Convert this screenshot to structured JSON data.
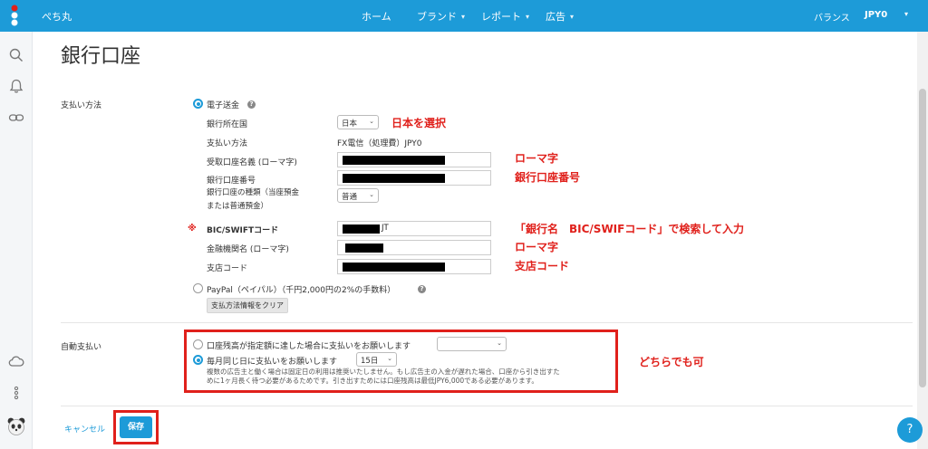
{
  "topbar": {
    "brand": "ぺち丸",
    "nav": [
      {
        "label": "ホーム",
        "has_menu": false
      },
      {
        "label": "ブランド",
        "has_menu": true
      },
      {
        "label": "レポート",
        "has_menu": true
      },
      {
        "label": "広告",
        "has_menu": true
      }
    ],
    "balance_label": "バランス",
    "balance_value": "JPY0"
  },
  "page": {
    "title": "銀行口座"
  },
  "payment": {
    "section_label": "支払い方法",
    "wire": {
      "label": "電子送金",
      "selected": true,
      "bank_country_label": "銀行所在国",
      "bank_country_value": "日本",
      "method_label": "支払い方法",
      "method_value": "FX電信（処理費）JPY0",
      "account_name_label": "受取口座名義 (ローマ字)",
      "account_number_label": "銀行口座番号",
      "account_type_label": "銀行口座の種類（当座預金",
      "account_type_label_2": "または普通預金）",
      "account_type_value": "普通",
      "swift_label": "BIC/SWIFTコード",
      "swift_tail": "JT",
      "bank_name_label": "金融機関名 (ローマ字)",
      "branch_label": "支店コード"
    },
    "paypal": {
      "label": "PayPal（ペイパル）（千円2,000円の2%の手数料）",
      "selected": false
    },
    "clear_button": "支払方法情報をクリア"
  },
  "auto_pay": {
    "section_label": "自動支払い",
    "option1": {
      "label": "口座残高が指定額に達した場合に支払いをお願いします",
      "selected": false,
      "value": ""
    },
    "option2": {
      "label": "毎月同じ日に支払いをお願いします",
      "selected": true,
      "value": "15日"
    },
    "note_1": "複数の広告主と働く場合は固定日の利用は推奨いたしません。もし広告主の入金が遅れた場合、口座から引き出すた",
    "note_2": "めに1ヶ月長く待つ必要があるためです。引き出すためには口座残高は最低JPY6,000である必要があります。"
  },
  "footer": {
    "cancel": "キャンセル",
    "save": "保存"
  },
  "annotations": {
    "select_japan": "日本を選択",
    "romaji_1": "ローマ字",
    "account_number": "銀行口座番号",
    "swift_hint": "「銀行名　BIC/SWIFコード」で検索して入力",
    "romaji_2": "ローマ字",
    "branch_code": "支店コード",
    "either_ok": "どちらでも可",
    "required_mark": "※"
  },
  "help_fab": "?",
  "colors": {
    "brand": "#1d9bd8",
    "annotation": "#e0201b"
  },
  "icons": [
    "search-icon",
    "bell-icon",
    "link-icon",
    "cloud-icon",
    "more-icon",
    "panda-avatar"
  ]
}
